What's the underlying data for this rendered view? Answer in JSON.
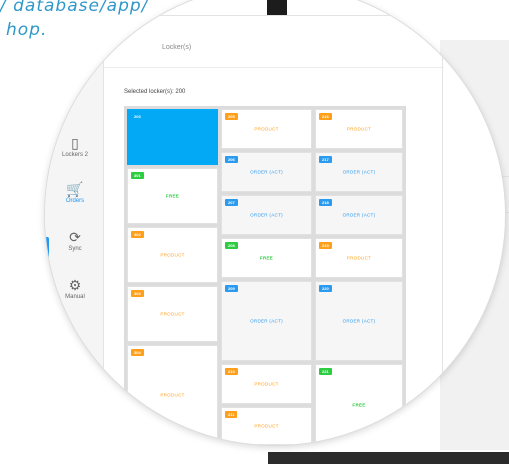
{
  "caption": {
    "line1": "/ database/app/",
    "line2": "hop."
  },
  "modal": {
    "title": "Locker(s)",
    "selected_label": "Selected locker(s): 200"
  },
  "nav": [
    {
      "icon": "locker-icon",
      "glyph": "▯",
      "label": "Lockers 2"
    },
    {
      "icon": "cart-icon",
      "glyph": "🛒",
      "label": "Orders"
    },
    {
      "icon": "sync-icon",
      "glyph": "⟳",
      "label": "Sync"
    },
    {
      "icon": "gear-icon",
      "glyph": "⚙",
      "label": "Manual"
    }
  ],
  "colors": {
    "selected": "#03a9f4",
    "product": "#ff9f1a",
    "order": "#2b9bf0",
    "free": "#2ecc40",
    "caption": "#2f98c9"
  },
  "lockers": [
    {
      "id": "203",
      "status": "selected",
      "text": ""
    },
    {
      "id": "301",
      "status": "free",
      "text": "FREE"
    },
    {
      "id": "302",
      "status": "product",
      "text": "PRODUCT"
    },
    {
      "id": "303",
      "status": "product",
      "text": "PRODUCT"
    },
    {
      "id": "304",
      "status": "product",
      "text": "PRODUCT"
    },
    {
      "id": "205",
      "status": "product",
      "text": "PRODUCT"
    },
    {
      "id": "206",
      "status": "order",
      "text": "ORDER (ACT)"
    },
    {
      "id": "207",
      "status": "order",
      "text": "ORDER (ACT)"
    },
    {
      "id": "208",
      "status": "free",
      "text": "FREE"
    },
    {
      "id": "209",
      "status": "order",
      "text": "ORDER (ACT)"
    },
    {
      "id": "210",
      "status": "product",
      "text": "PRODUCT"
    },
    {
      "id": "211",
      "status": "product",
      "text": "PRODUCT"
    },
    {
      "id": "216",
      "status": "product",
      "text": "PRODUCT"
    },
    {
      "id": "217",
      "status": "order",
      "text": "ORDER (ACT)"
    },
    {
      "id": "218",
      "status": "order",
      "text": "ORDER (ACT)"
    },
    {
      "id": "219",
      "status": "product",
      "text": "PRODUCT"
    },
    {
      "id": "220",
      "status": "order",
      "text": "ORDER (ACT)"
    },
    {
      "id": "221",
      "status": "free",
      "text": "FREE"
    }
  ]
}
